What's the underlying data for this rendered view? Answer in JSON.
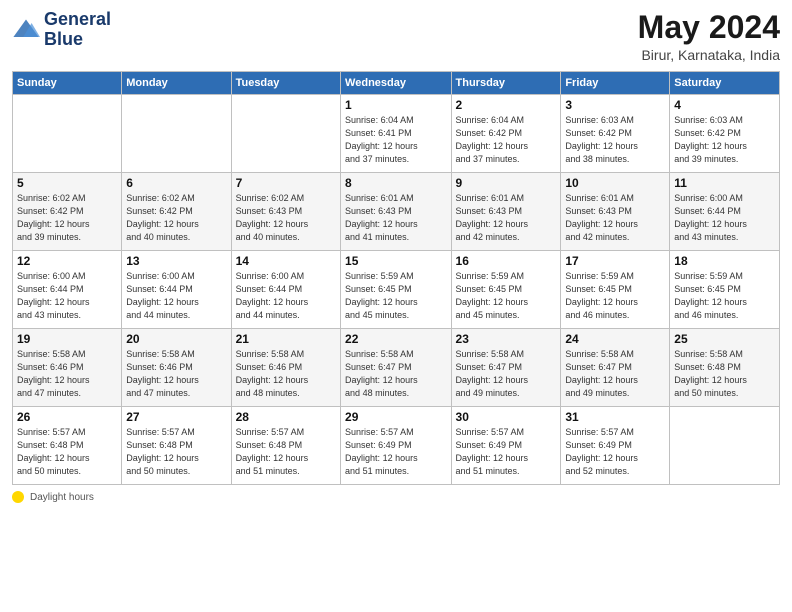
{
  "app": {
    "logo_line1": "General",
    "logo_line2": "Blue"
  },
  "calendar": {
    "title": "May 2024",
    "subtitle": "Birur, Karnataka, India",
    "days_of_week": [
      "Sunday",
      "Monday",
      "Tuesday",
      "Wednesday",
      "Thursday",
      "Friday",
      "Saturday"
    ],
    "weeks": [
      [
        {
          "day": "",
          "info": ""
        },
        {
          "day": "",
          "info": ""
        },
        {
          "day": "",
          "info": ""
        },
        {
          "day": "1",
          "info": "Sunrise: 6:04 AM\nSunset: 6:41 PM\nDaylight: 12 hours\nand 37 minutes."
        },
        {
          "day": "2",
          "info": "Sunrise: 6:04 AM\nSunset: 6:42 PM\nDaylight: 12 hours\nand 37 minutes."
        },
        {
          "day": "3",
          "info": "Sunrise: 6:03 AM\nSunset: 6:42 PM\nDaylight: 12 hours\nand 38 minutes."
        },
        {
          "day": "4",
          "info": "Sunrise: 6:03 AM\nSunset: 6:42 PM\nDaylight: 12 hours\nand 39 minutes."
        }
      ],
      [
        {
          "day": "5",
          "info": "Sunrise: 6:02 AM\nSunset: 6:42 PM\nDaylight: 12 hours\nand 39 minutes."
        },
        {
          "day": "6",
          "info": "Sunrise: 6:02 AM\nSunset: 6:42 PM\nDaylight: 12 hours\nand 40 minutes."
        },
        {
          "day": "7",
          "info": "Sunrise: 6:02 AM\nSunset: 6:43 PM\nDaylight: 12 hours\nand 40 minutes."
        },
        {
          "day": "8",
          "info": "Sunrise: 6:01 AM\nSunset: 6:43 PM\nDaylight: 12 hours\nand 41 minutes."
        },
        {
          "day": "9",
          "info": "Sunrise: 6:01 AM\nSunset: 6:43 PM\nDaylight: 12 hours\nand 42 minutes."
        },
        {
          "day": "10",
          "info": "Sunrise: 6:01 AM\nSunset: 6:43 PM\nDaylight: 12 hours\nand 42 minutes."
        },
        {
          "day": "11",
          "info": "Sunrise: 6:00 AM\nSunset: 6:44 PM\nDaylight: 12 hours\nand 43 minutes."
        }
      ],
      [
        {
          "day": "12",
          "info": "Sunrise: 6:00 AM\nSunset: 6:44 PM\nDaylight: 12 hours\nand 43 minutes."
        },
        {
          "day": "13",
          "info": "Sunrise: 6:00 AM\nSunset: 6:44 PM\nDaylight: 12 hours\nand 44 minutes."
        },
        {
          "day": "14",
          "info": "Sunrise: 6:00 AM\nSunset: 6:44 PM\nDaylight: 12 hours\nand 44 minutes."
        },
        {
          "day": "15",
          "info": "Sunrise: 5:59 AM\nSunset: 6:45 PM\nDaylight: 12 hours\nand 45 minutes."
        },
        {
          "day": "16",
          "info": "Sunrise: 5:59 AM\nSunset: 6:45 PM\nDaylight: 12 hours\nand 45 minutes."
        },
        {
          "day": "17",
          "info": "Sunrise: 5:59 AM\nSunset: 6:45 PM\nDaylight: 12 hours\nand 46 minutes."
        },
        {
          "day": "18",
          "info": "Sunrise: 5:59 AM\nSunset: 6:45 PM\nDaylight: 12 hours\nand 46 minutes."
        }
      ],
      [
        {
          "day": "19",
          "info": "Sunrise: 5:58 AM\nSunset: 6:46 PM\nDaylight: 12 hours\nand 47 minutes."
        },
        {
          "day": "20",
          "info": "Sunrise: 5:58 AM\nSunset: 6:46 PM\nDaylight: 12 hours\nand 47 minutes."
        },
        {
          "day": "21",
          "info": "Sunrise: 5:58 AM\nSunset: 6:46 PM\nDaylight: 12 hours\nand 48 minutes."
        },
        {
          "day": "22",
          "info": "Sunrise: 5:58 AM\nSunset: 6:47 PM\nDaylight: 12 hours\nand 48 minutes."
        },
        {
          "day": "23",
          "info": "Sunrise: 5:58 AM\nSunset: 6:47 PM\nDaylight: 12 hours\nand 49 minutes."
        },
        {
          "day": "24",
          "info": "Sunrise: 5:58 AM\nSunset: 6:47 PM\nDaylight: 12 hours\nand 49 minutes."
        },
        {
          "day": "25",
          "info": "Sunrise: 5:58 AM\nSunset: 6:48 PM\nDaylight: 12 hours\nand 50 minutes."
        }
      ],
      [
        {
          "day": "26",
          "info": "Sunrise: 5:57 AM\nSunset: 6:48 PM\nDaylight: 12 hours\nand 50 minutes."
        },
        {
          "day": "27",
          "info": "Sunrise: 5:57 AM\nSunset: 6:48 PM\nDaylight: 12 hours\nand 50 minutes."
        },
        {
          "day": "28",
          "info": "Sunrise: 5:57 AM\nSunset: 6:48 PM\nDaylight: 12 hours\nand 51 minutes."
        },
        {
          "day": "29",
          "info": "Sunrise: 5:57 AM\nSunset: 6:49 PM\nDaylight: 12 hours\nand 51 minutes."
        },
        {
          "day": "30",
          "info": "Sunrise: 5:57 AM\nSunset: 6:49 PM\nDaylight: 12 hours\nand 51 minutes."
        },
        {
          "day": "31",
          "info": "Sunrise: 5:57 AM\nSunset: 6:49 PM\nDaylight: 12 hours\nand 52 minutes."
        },
        {
          "day": "",
          "info": ""
        }
      ]
    ]
  },
  "footer": {
    "legend_label": "Daylight hours"
  }
}
